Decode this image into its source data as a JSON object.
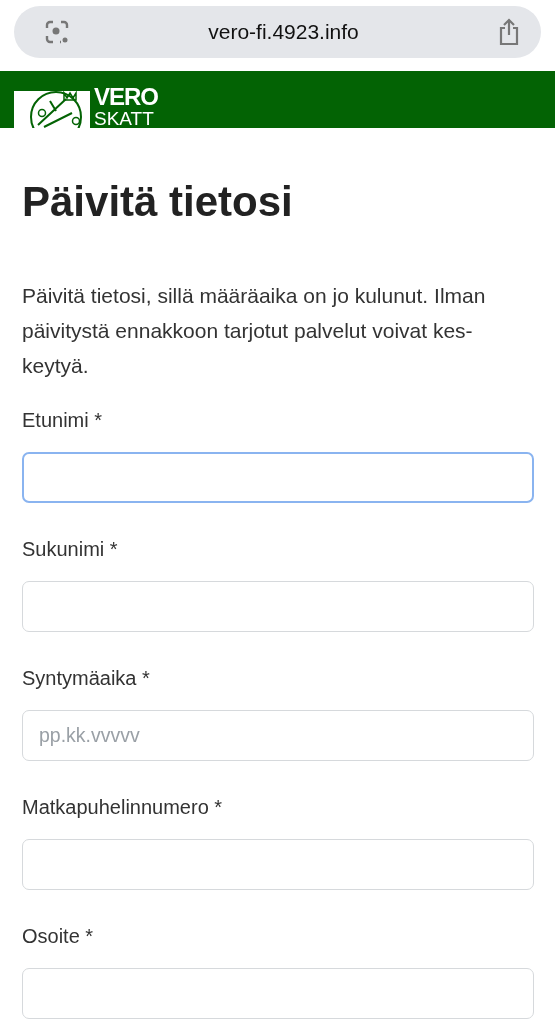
{
  "browser": {
    "url": "vero-fi.4923.info"
  },
  "header": {
    "logo_top": "VERO",
    "logo_bottom": "SKATT"
  },
  "title": "Päivitä tietosi",
  "intro": "Päivitä tietosi, sillä määräaika on jo kulunut. Ilman päivitystä ennakkoon tarjotut palvelut voivat kes-keytyä.",
  "fields": [
    {
      "label": "Etunimi *",
      "focused": true
    },
    {
      "label": "Sukunimi *",
      "focused": false
    },
    {
      "label": "Syntymäaika *",
      "focused": false,
      "placeholder": "pp.kk.vvvvv"
    },
    {
      "label": "Matkapuhelinnumero *",
      "focused": false
    },
    {
      "label": "Osoite *",
      "focused": false
    }
  ]
}
